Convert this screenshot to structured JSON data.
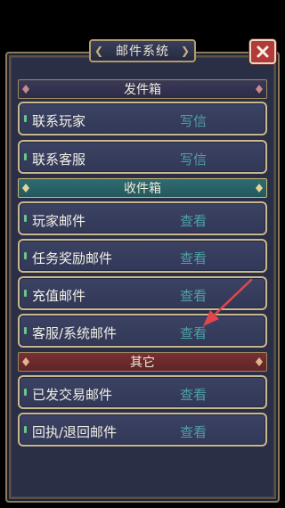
{
  "window": {
    "title": "邮件系统"
  },
  "sections": {
    "send": {
      "header": "发件箱"
    },
    "receive": {
      "header": "收件箱"
    },
    "other": {
      "header": "其它"
    }
  },
  "rows": [
    {
      "label": "联系玩家",
      "action": "写信"
    },
    {
      "label": "联系客服",
      "action": "写信"
    },
    {
      "label": "玩家邮件",
      "action": "查看"
    },
    {
      "label": "任务奖励邮件",
      "action": "查看"
    },
    {
      "label": "充值邮件",
      "action": "查看"
    },
    {
      "label": "客服/系统邮件",
      "action": "查看"
    },
    {
      "label": "已发交易邮件",
      "action": "查看"
    },
    {
      "label": "回执/退回邮件",
      "action": "查看"
    }
  ],
  "icons": {
    "close": "close-icon",
    "arrow": "arrow-annotation-icon"
  },
  "colors": {
    "action_text": "#4ea1a6",
    "close_button": "#b23a3a",
    "annotation_arrow": "#e0474c"
  }
}
